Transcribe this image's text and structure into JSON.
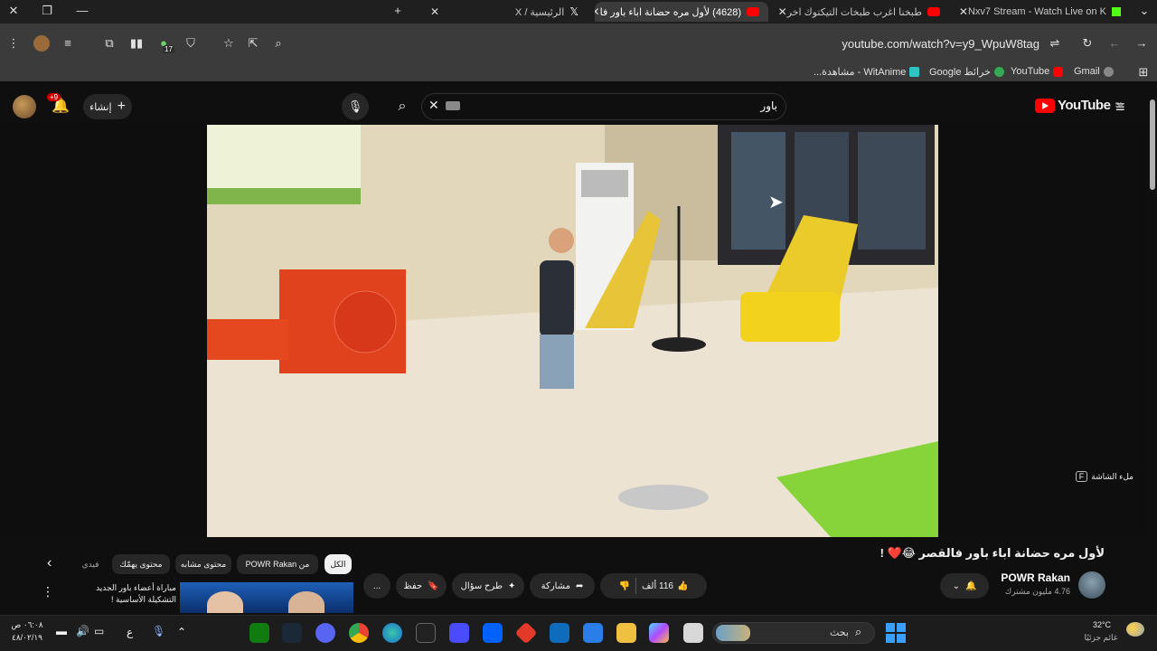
{
  "browser": {
    "tabs": [
      {
        "label": "Nxv7 Stream - Watch Live on K",
        "favicon": "kick-icon"
      },
      {
        "label": "طبخنا اغرب طبخات التيكتوك اخر",
        "favicon": "youtube-icon"
      },
      {
        "label": "(4628) لأول مره حضانة اباء باور فا",
        "favicon": "youtube-icon",
        "active": true
      },
      {
        "label": "الرئيسية / X",
        "favicon": "x-icon"
      }
    ],
    "new_tab": "+",
    "url": "youtube.com/watch?v=y9_WpuW8tag",
    "extension_badge": "17",
    "bookmarks": [
      {
        "label": "Gmail",
        "icon": "gmail-icon"
      },
      {
        "label": "YouTube",
        "icon": "youtube-icon"
      },
      {
        "label": "خرائط Google",
        "icon": "maps-icon"
      },
      {
        "label": "WitAnime - مشاهدة...",
        "icon": "witanime-icon"
      }
    ]
  },
  "youtube": {
    "logo_text": "YouTube",
    "region": "SA",
    "search_query": "باور",
    "create_label": "إنشاء",
    "notif_badge": "+9",
    "fullscreen_hint": "ملء الشاشة",
    "fullscreen_key": "F",
    "video": {
      "title": "لأول مره حضانة اباء باور فالقصر 😂❤️ !",
      "channel": "POWR Rakan",
      "subscribers": "4.76 مليون مشترك",
      "likes": "116 ألف",
      "share": "مشاركة",
      "ask": "طرح سؤال",
      "save": "حفظ",
      "more": "..."
    },
    "chips": [
      "الكل",
      "من POWR Rakan",
      "محتوى مشابه",
      "محتوى يهمّك",
      "فيدي"
    ],
    "recommended": {
      "title": "مباراة أعضاء باور الجديد التشكيلة الأساسية !"
    }
  },
  "taskbar": {
    "weather_temp": "32°C",
    "weather_desc": "غائم جزئيًا",
    "search_label": "بحث",
    "time": "٠٦:٠٨ ص",
    "date": "٤٨/٠٢/١٩",
    "lang": "ع"
  }
}
